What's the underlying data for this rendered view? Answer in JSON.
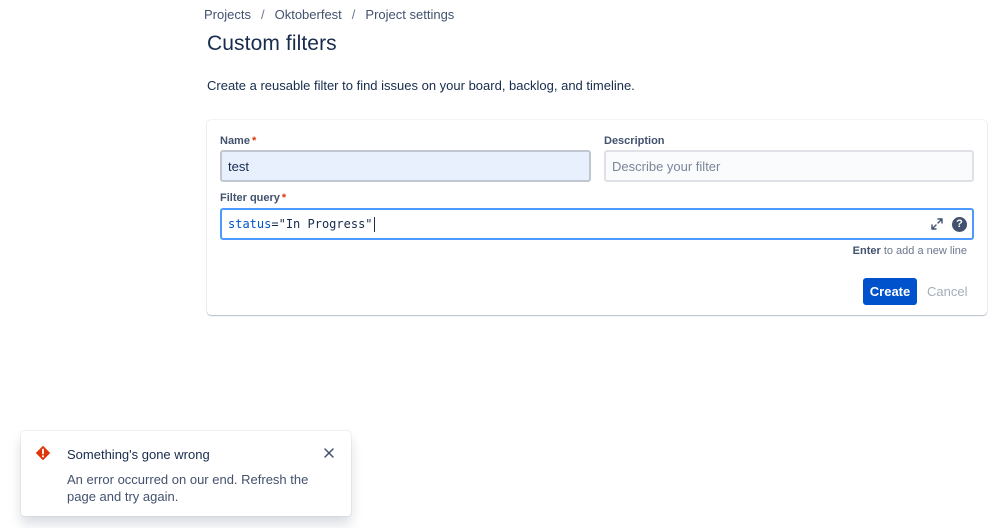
{
  "breadcrumb": {
    "items": [
      "Projects",
      "Oktoberfest",
      "Project settings"
    ],
    "separator": "/"
  },
  "page": {
    "title": "Custom filters",
    "description": "Create a reusable filter to find issues on your board, backlog, and timeline."
  },
  "form": {
    "name": {
      "label": "Name",
      "required_mark": "*",
      "value": "test"
    },
    "description": {
      "label": "Description",
      "placeholder": "Describe your filter",
      "value": ""
    },
    "query": {
      "label": "Filter query",
      "required_mark": "*",
      "keyword": "status",
      "operator": "=",
      "literal": "\"In Progress\"",
      "expand_icon": "expand-arrows-icon",
      "help_icon": "help-icon",
      "help_glyph": "?"
    },
    "hint": {
      "key": "Enter",
      "text": "to add a new line"
    },
    "create_label": "Create",
    "cancel_label": "Cancel"
  },
  "flag": {
    "icon": "error-icon",
    "title": "Something's gone wrong",
    "body": "An error occurred on our end. Refresh the page and try again.",
    "close_icon": "close-icon"
  },
  "colors": {
    "primary": "#0052cc",
    "error": "#de350b",
    "text": "#172b4d",
    "focus": "#4c9aff"
  }
}
